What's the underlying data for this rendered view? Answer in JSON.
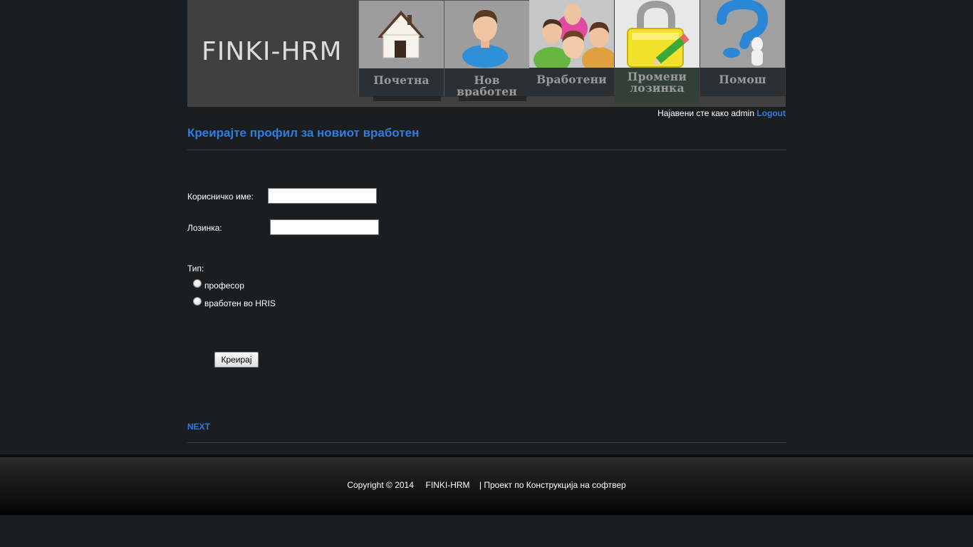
{
  "header": {
    "logo": "FINKI-HRM",
    "nav": [
      {
        "label": "Почетна",
        "icon": "house-icon"
      },
      {
        "label": "Нов вработен",
        "icon": "new-employee-icon"
      },
      {
        "label": "Вработени",
        "icon": "employees-group-icon"
      },
      {
        "label": "Промени лозинка",
        "icon": "padlock-pencil-icon"
      },
      {
        "label": "Помош",
        "icon": "question-mark-icon"
      }
    ],
    "login_text": "Најавени сте како admin",
    "logout": "Logout"
  },
  "main": {
    "title": "Креирајте профил за новиот вработен",
    "username_label": "Корисничко име:",
    "username_value": "",
    "password_label": "Лозинка:",
    "password_value": "",
    "type_label": "Тип:",
    "type_options": [
      "професор",
      "вработен во HRIS"
    ],
    "submit_label": "Креирај",
    "next_link": "NEXT"
  },
  "footer": {
    "text": "Copyright © 2014     FINKI-HRM    | Проект по Конструкција на софтвер"
  },
  "colors": {
    "background": "#1b1e20",
    "accent": "#2f7de0",
    "header_bg": "#404040"
  }
}
